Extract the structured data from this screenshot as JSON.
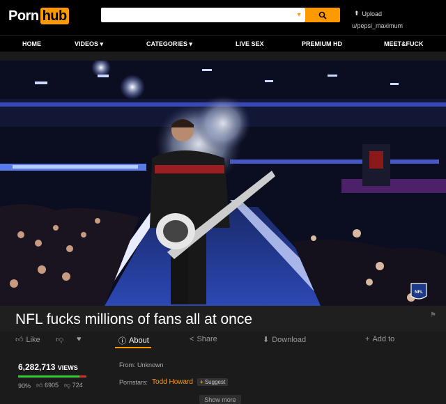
{
  "header": {
    "logo_part1": "Porn",
    "logo_part2": "hub",
    "search_value": "",
    "upload_label": "Upload",
    "username": "u/pepsi_maximum"
  },
  "nav": {
    "items": [
      {
        "label": "HOME"
      },
      {
        "label": "VIDEOS ▾"
      },
      {
        "label": "CATEGORIES ▾"
      },
      {
        "label": "LIVE SEX"
      },
      {
        "label": "PREMIUM HD"
      },
      {
        "label": "MEET&FUCK"
      }
    ]
  },
  "video": {
    "title": "NFL fucks millions of fans all at once",
    "badge": "NFL"
  },
  "actions": {
    "like": "Like",
    "about": "About",
    "share": "Share",
    "download": "Download",
    "add_to": "Add to"
  },
  "stats": {
    "views_count": "6,282,713",
    "views_label": "VIEWS",
    "rating_percent": "90%",
    "rating_fraction": 0.9,
    "likes": "6905",
    "dislikes": "724"
  },
  "details": {
    "from_label": "From:",
    "from_value": "Unknown",
    "pornstars_label": "Pornstars:",
    "pornstar": "Todd Howard",
    "suggest_label": "Suggest",
    "show_more": "Show more"
  },
  "colors": {
    "accent": "#ff9900",
    "background": "#1b1b1b",
    "header_bg": "#000000"
  }
}
